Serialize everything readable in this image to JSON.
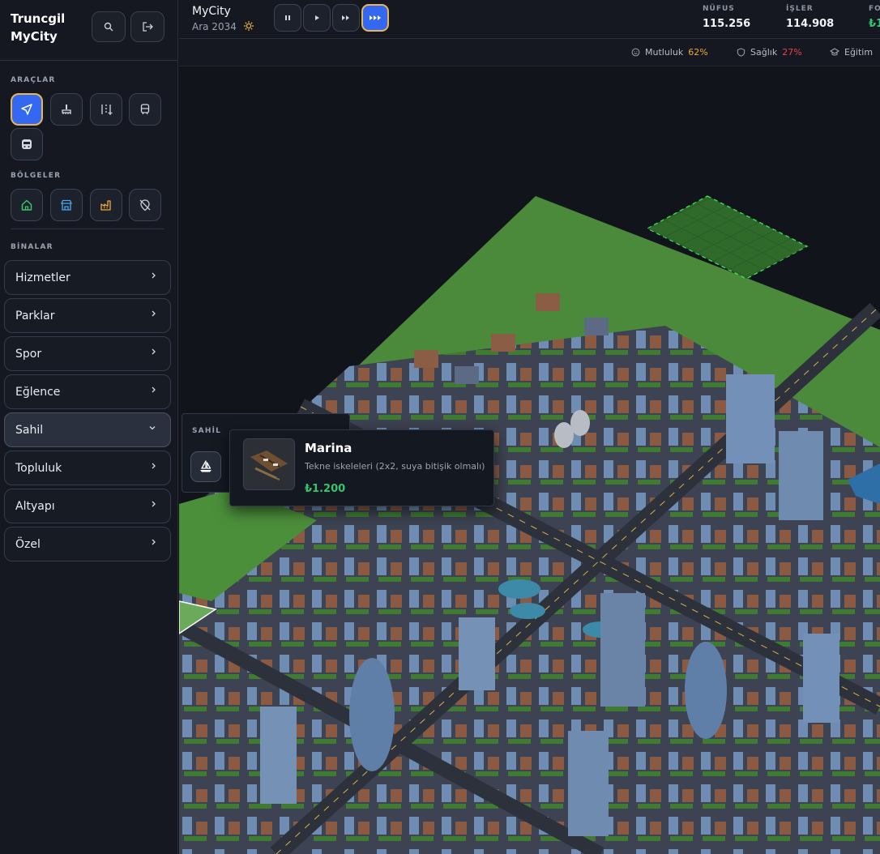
{
  "app": {
    "brand_line1": "Truncgil",
    "brand_line2": "MyCity"
  },
  "sidebar": {
    "sections": {
      "tools_title": "ARAÇLAR",
      "zones_title": "BÖLGELER",
      "buildings_title": "BİNALAR"
    },
    "tools": [
      {
        "icon": "cursor-icon",
        "active": true
      },
      {
        "icon": "bulldoze-icon",
        "active": false
      },
      {
        "icon": "road-icon",
        "active": false
      },
      {
        "icon": "rail-icon",
        "active": false
      },
      {
        "icon": "subway-icon",
        "active": false
      }
    ],
    "zones": [
      {
        "icon": "residential-icon",
        "color": "#3cc46a"
      },
      {
        "icon": "commercial-icon",
        "color": "#4aa8f0"
      },
      {
        "icon": "industrial-icon",
        "color": "#f0a83a"
      },
      {
        "icon": "dezone-icon",
        "color": "#c9ced8"
      }
    ],
    "categories": [
      {
        "label": "Hizmetler",
        "open": false
      },
      {
        "label": "Parklar",
        "open": false
      },
      {
        "label": "Spor",
        "open": false
      },
      {
        "label": "Eğlence",
        "open": false
      },
      {
        "label": "Sahil",
        "open": true
      },
      {
        "label": "Topluluk",
        "open": false
      },
      {
        "label": "Altyapı",
        "open": false
      },
      {
        "label": "Özel",
        "open": false
      }
    ]
  },
  "topbar": {
    "city_name": "MyCity",
    "date": "Ara 2034",
    "speed_active_index": 3,
    "stats": [
      {
        "label": "NÜFUS",
        "value": "115.256"
      },
      {
        "label": "İŞLER",
        "value": "114.908"
      },
      {
        "label": "FO",
        "value": "₺1"
      }
    ]
  },
  "metrics": [
    {
      "label": "Mutluluk",
      "value": "62%",
      "color": "#f0a83a"
    },
    {
      "label": "Sağlık",
      "value": "27%",
      "color": "#e0484a"
    },
    {
      "label": "Eğitim",
      "value": "",
      "color": "#c9ced8"
    }
  ],
  "sahil_panel": {
    "title": "SAHİL"
  },
  "tooltip": {
    "name": "Marina",
    "description": "Tekne iskeleleri (2x2, suya bitişik olmalı)",
    "price": "₺1.200"
  },
  "colors": {
    "accent": "#3468f0",
    "active_border": "#e8b557",
    "price": "#35c46b"
  }
}
